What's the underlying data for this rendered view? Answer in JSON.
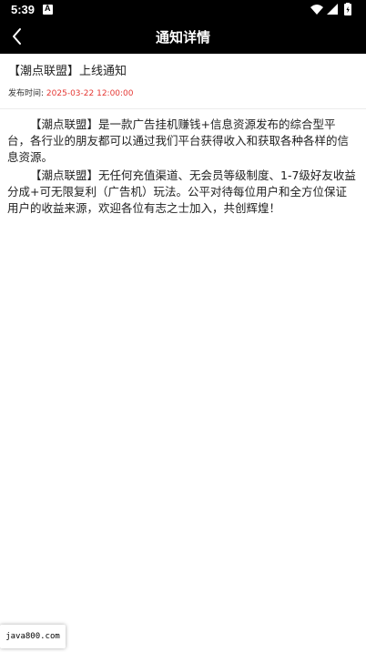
{
  "status_bar": {
    "time": "5:39",
    "icons": [
      "app-notification-icon",
      "wifi-icon",
      "signal-icon",
      "battery-icon"
    ]
  },
  "app_bar": {
    "title": "通知详情",
    "back_icon": "chevron-left-icon"
  },
  "notice": {
    "title": "【潮点联盟】上线通知",
    "meta_label": "发布时间:",
    "meta_value": "2025-03-22 12:00:00",
    "paragraphs": [
      "【潮点联盟】是一款广告挂机赚钱+信息资源发布的综合型平台，各行业的朋友都可以通过我们平台获得收入和获取各种各样的信息资源。",
      "【潮点联盟】无任何充值渠道、无会员等级制度、1-7级好友收益分成+可无限复利（广告机）玩法。公平对待每位用户和全方位保证用户的收益来源，欢迎各位有志之士加入，共创辉煌！"
    ]
  },
  "watermark": {
    "text": "java800.com"
  },
  "colors": {
    "bar_background": "#000000",
    "meta_value": "#e53935",
    "body_text": "#222222"
  }
}
